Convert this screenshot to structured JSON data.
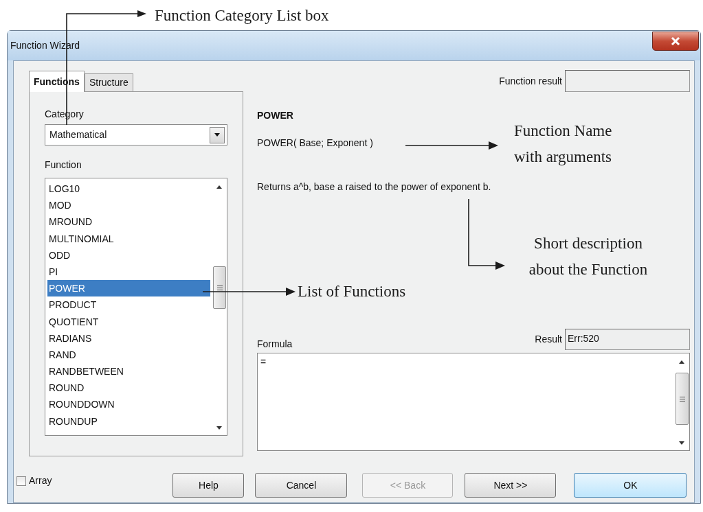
{
  "window": {
    "title": "Function Wizard"
  },
  "tabs": [
    {
      "label": "Functions",
      "selected": true
    },
    {
      "label": "Structure",
      "selected": false
    }
  ],
  "category": {
    "label": "Category",
    "value": "Mathematical"
  },
  "function_list": {
    "label": "Function",
    "items": [
      {
        "name": "LOG10",
        "selected": false
      },
      {
        "name": "MOD",
        "selected": false
      },
      {
        "name": "MROUND",
        "selected": false
      },
      {
        "name": "MULTINOMIAL",
        "selected": false
      },
      {
        "name": "ODD",
        "selected": false
      },
      {
        "name": "PI",
        "selected": false
      },
      {
        "name": "POWER",
        "selected": true
      },
      {
        "name": "PRODUCT",
        "selected": false
      },
      {
        "name": "QUOTIENT",
        "selected": false
      },
      {
        "name": "RADIANS",
        "selected": false
      },
      {
        "name": "RAND",
        "selected": false
      },
      {
        "name": "RANDBETWEEN",
        "selected": false
      },
      {
        "name": "ROUND",
        "selected": false
      },
      {
        "name": "ROUNDDOWN",
        "selected": false
      },
      {
        "name": "ROUNDUP",
        "selected": false
      }
    ]
  },
  "function_result": {
    "label": "Function result"
  },
  "function_name": "POWER",
  "signature": "POWER( Base; Exponent )",
  "description": "Returns a^b, base a raised to the power of exponent b.",
  "result": {
    "label": "Result",
    "value": "Err:520"
  },
  "formula": {
    "label": "Formula",
    "value": "="
  },
  "array": {
    "label": "Array",
    "checked": false
  },
  "buttons": [
    {
      "label": "Help",
      "disabled": false,
      "default": false,
      "kind": "help"
    },
    {
      "label": "Cancel",
      "disabled": false,
      "default": false,
      "kind": "cancel"
    },
    {
      "label": "<< Back",
      "disabled": true,
      "default": false,
      "kind": "back"
    },
    {
      "label": "Next >>",
      "disabled": false,
      "default": false,
      "kind": "next"
    },
    {
      "label": "OK",
      "disabled": false,
      "default": true,
      "kind": "ok"
    }
  ],
  "annotations": [
    {
      "kind": "category",
      "lines": [
        "Function Category List box"
      ]
    },
    {
      "kind": "name",
      "lines": [
        "Function Name",
        "with arguments"
      ]
    },
    {
      "kind": "description",
      "lines": [
        "Short description",
        "about the Function"
      ]
    },
    {
      "kind": "list",
      "lines": [
        "List of Functions"
      ]
    }
  ]
}
